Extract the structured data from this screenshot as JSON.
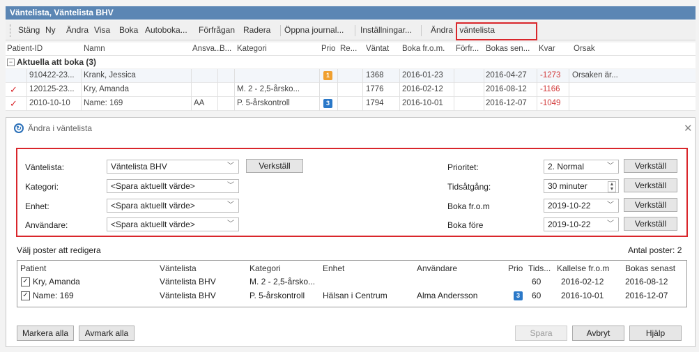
{
  "window": {
    "title": "Väntelista, Väntelista BHV"
  },
  "toolbar": {
    "items": [
      "Stäng",
      "Ny",
      "Ändra",
      "Visa",
      "Boka",
      "Autoboka...",
      "Förfrågan",
      "Radera",
      "Öppna journal...",
      "Inställningar...",
      "Ändra i väntelista"
    ]
  },
  "grid": {
    "columns": [
      "Patient-ID",
      "Namn",
      "Ansva...",
      "B...",
      "Kategori",
      "Prio",
      "Re...",
      "Väntat",
      "Boka fr.o.m.",
      "Förfr...",
      "Bokas sen...",
      "Kvar",
      "Orsak"
    ],
    "group_label": "Aktuella att boka (3)",
    "rows": [
      {
        "checked": "",
        "id": "910422-23...",
        "name": "Krank, Jessica",
        "ansv": "",
        "kategori": "",
        "prio": "1",
        "waited": "1368",
        "boka_from": "2016-01-23",
        "bokas_senast": "2016-04-27",
        "kvar": "-1273",
        "orsak": "Orsaken är..."
      },
      {
        "checked": "✓",
        "id": "120125-23...",
        "name": "Kry, Amanda",
        "ansv": "",
        "kategori": "M. 2 - 2,5-årsko...",
        "prio": "",
        "waited": "1776",
        "boka_from": "2016-02-12",
        "bokas_senast": "2016-08-12",
        "kvar": "-1166",
        "orsak": ""
      },
      {
        "checked": "✓",
        "id": "2010-10-10",
        "name": "Name: 169",
        "ansv": "AA",
        "kategori": "P. 5-årskontroll",
        "prio": "3",
        "waited": "1794",
        "boka_from": "2016-10-01",
        "bokas_senast": "2016-12-07",
        "kvar": "-1049",
        "orsak": ""
      }
    ]
  },
  "dialog": {
    "title": "Ändra i väntelista",
    "left_fields": [
      {
        "label": "Väntelista:",
        "value": "Väntelista BHV"
      },
      {
        "label": "Kategori:",
        "value": "<Spara aktuellt värde>"
      },
      {
        "label": "Enhet:",
        "value": "<Spara aktuellt värde>"
      },
      {
        "label": "Användare:",
        "value": "<Spara aktuellt värde>"
      }
    ],
    "apply_label": "Verkställ",
    "right_fields": [
      {
        "label": "Prioritet:",
        "value": "2. Normal"
      },
      {
        "label": "Tidsåtgång:",
        "value": "30 minuter"
      },
      {
        "label": "Boka fr.o.m",
        "value": "2019-10-22"
      },
      {
        "label": "Boka före",
        "value": "2019-10-22"
      }
    ],
    "select_label": "Välj poster att redigera",
    "count_label": "Antal poster: 2",
    "list_columns": [
      "Patient",
      "Väntelista",
      "Kategori",
      "Enhet",
      "Användare",
      "Prio",
      "Tids...",
      "Kallelse fr.o.m",
      "Bokas senast"
    ],
    "list_rows": [
      {
        "patient": "Kry, Amanda",
        "lista": "Väntelista BHV",
        "kategori": "M. 2 - 2,5-årsko...",
        "enhet": "",
        "anvandare": "",
        "prio": "",
        "tid": "60",
        "kallelse": "2016-02-12",
        "bokas": "2016-08-12"
      },
      {
        "patient": "Name: 169",
        "lista": "Väntelista BHV",
        "kategori": "P. 5-årskontroll",
        "enhet": "Hälsan i Centrum",
        "anvandare": "Alma Andersson",
        "prio": "3",
        "tid": "60",
        "kallelse": "2016-10-01",
        "bokas": "2016-12-07"
      }
    ],
    "buttons": {
      "mark_all": "Markera alla",
      "unmark_all": "Avmark alla",
      "save": "Spara",
      "cancel": "Avbryt",
      "help": "Hjälp"
    }
  },
  "colors": {
    "titlebar": "#5b86b4",
    "highlight_red": "#d9262b",
    "negative": "#d23a3a",
    "prio_orange": "#f0a030",
    "prio_blue": "#2a78c8"
  }
}
